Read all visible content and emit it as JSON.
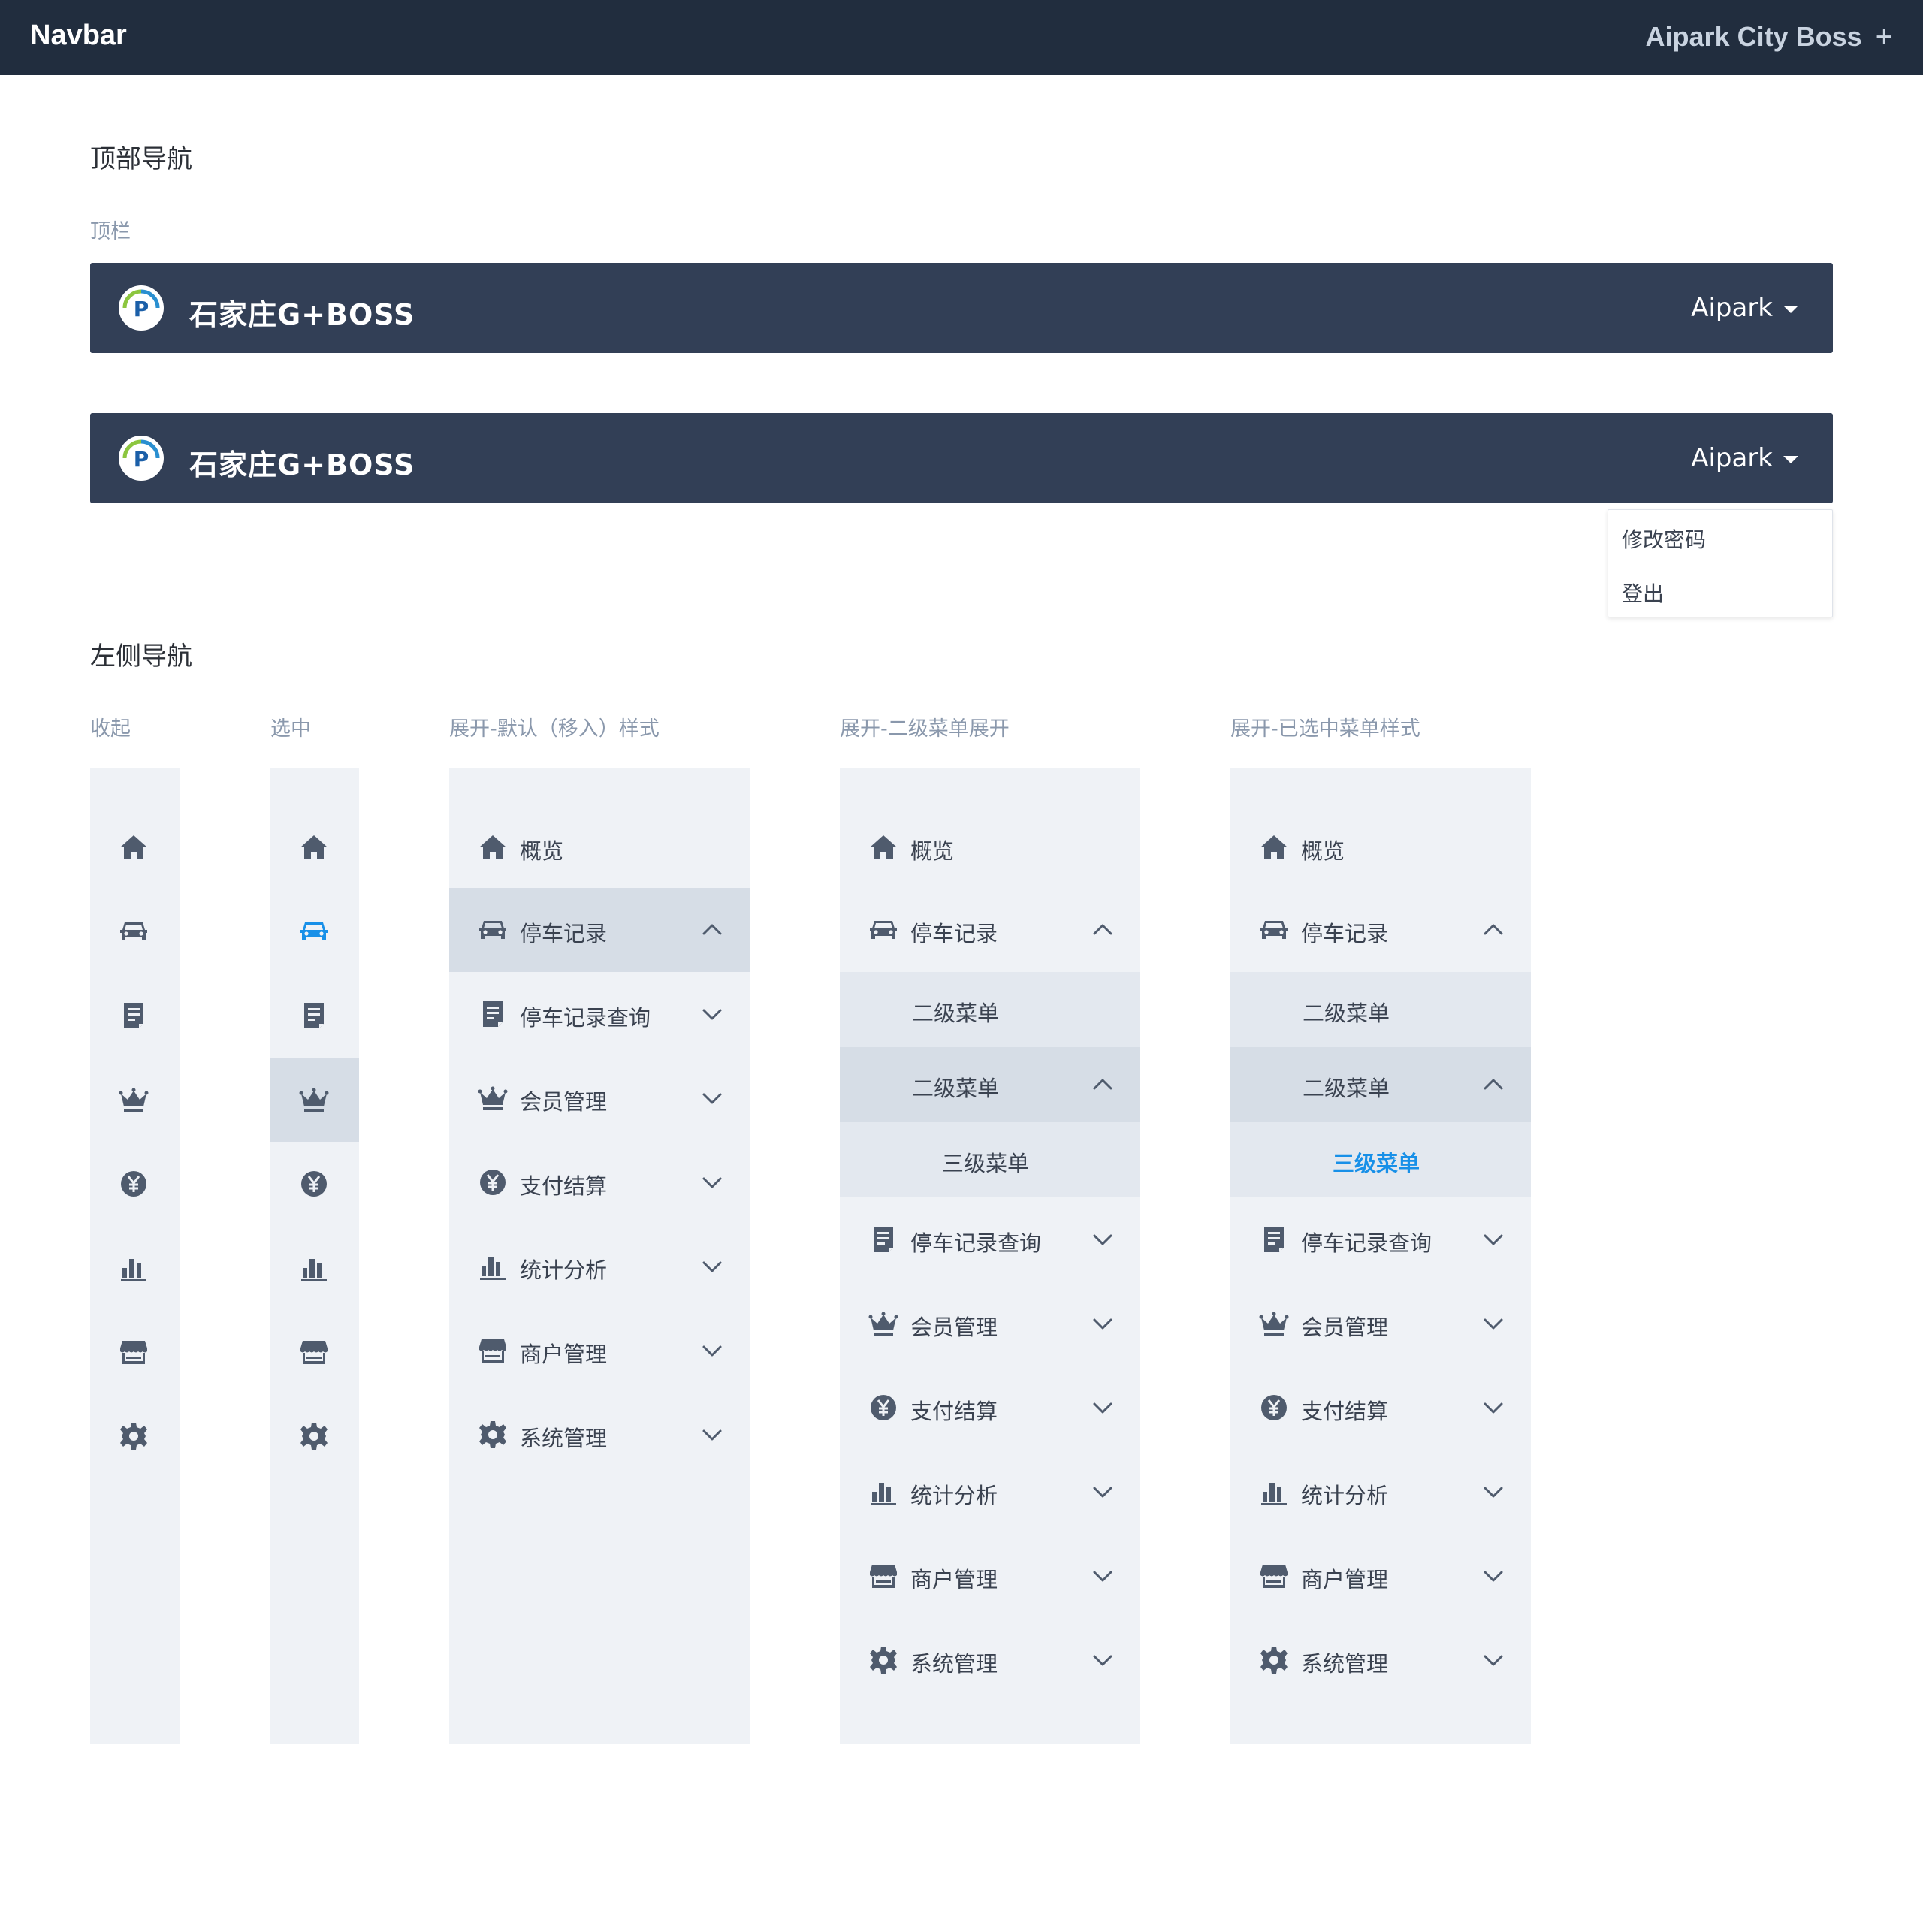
{
  "header": {
    "brand": "Navbar",
    "right_title": "Aipark City Boss",
    "plus": "+"
  },
  "top_nav": {
    "section_title": "顶部导航",
    "sub_label": "顶栏",
    "bar_title": "石家庄G+BOSS",
    "user": "Aipark",
    "dropdown": [
      "修改密码",
      "登出"
    ]
  },
  "left_nav": {
    "section_title": "左侧导航",
    "labels": {
      "collapsed": "收起",
      "selected": "选中",
      "expanded_default": "展开-默认（移入）样式",
      "expanded_submenu": "展开-二级菜单展开",
      "expanded_selected": "展开-已选中菜单样式"
    },
    "menu": [
      "概览",
      "停车记录",
      "停车记录查询",
      "会员管理",
      "支付结算",
      "统计分析",
      "商户管理",
      "系统管理"
    ],
    "submenu": {
      "level2_a": "二级菜单",
      "level2_b": "二级菜单",
      "level3": "三级菜单"
    }
  },
  "icons": [
    "home-icon",
    "car-icon",
    "document-icon",
    "crown-icon",
    "yen-icon",
    "bar-chart-icon",
    "store-icon",
    "gear-icon",
    "chevron-down-icon",
    "chevron-up-icon",
    "caret-down-icon",
    "parking-logo-icon"
  ],
  "colors": {
    "navbar": "#212d3e",
    "topbar": "#323f56",
    "sidebar": "#eff2f6",
    "active": "#d6dde6",
    "selected_text": "#1890e8",
    "icon": "#4f5b6d"
  }
}
